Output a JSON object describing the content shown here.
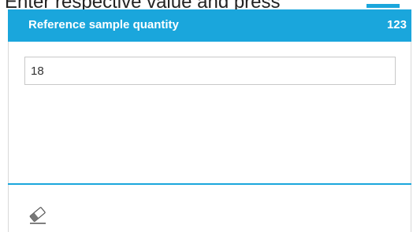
{
  "instruction": {
    "text": "Enter respective value and press"
  },
  "header": {
    "title": "Reference sample quantity",
    "code": "123"
  },
  "input": {
    "value": "18"
  },
  "footer": {
    "tool_icon": "eraser-icon"
  },
  "colors": {
    "accent": "#1aa6dc",
    "text": "#333333",
    "border": "#c8c8c8"
  }
}
